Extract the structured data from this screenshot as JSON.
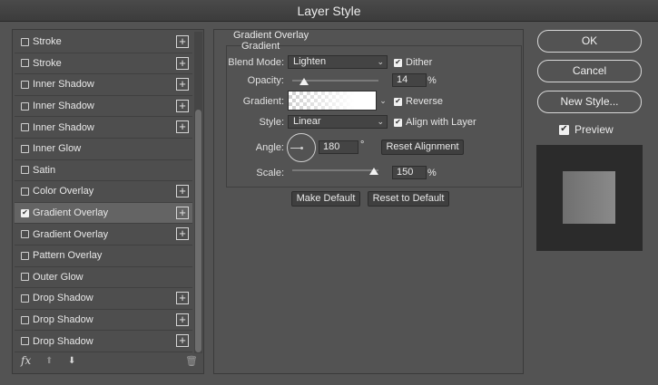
{
  "window": {
    "title": "Layer Style"
  },
  "styles_list": [
    {
      "label": "Stroke",
      "checked": false,
      "has_add": true
    },
    {
      "label": "Stroke",
      "checked": false,
      "has_add": true
    },
    {
      "label": "Inner Shadow",
      "checked": false,
      "has_add": true
    },
    {
      "label": "Inner Shadow",
      "checked": false,
      "has_add": true
    },
    {
      "label": "Inner Shadow",
      "checked": false,
      "has_add": true
    },
    {
      "label": "Inner Glow",
      "checked": false,
      "has_add": false
    },
    {
      "label": "Satin",
      "checked": false,
      "has_add": false
    },
    {
      "label": "Color Overlay",
      "checked": false,
      "has_add": true
    },
    {
      "label": "Gradient Overlay",
      "checked": true,
      "has_add": true,
      "selected": true
    },
    {
      "label": "Gradient Overlay",
      "checked": false,
      "has_add": true
    },
    {
      "label": "Pattern Overlay",
      "checked": false,
      "has_add": false
    },
    {
      "label": "Outer Glow",
      "checked": false,
      "has_add": false
    },
    {
      "label": "Drop Shadow",
      "checked": false,
      "has_add": true
    },
    {
      "label": "Drop Shadow",
      "checked": false,
      "has_add": true
    },
    {
      "label": "Drop Shadow",
      "checked": false,
      "has_add": true
    }
  ],
  "list_toolbar": {
    "fx_label": "fx",
    "up_icon": "arrow-up-icon",
    "down_icon": "arrow-down-icon",
    "trash_icon": "trash-icon"
  },
  "gradient_overlay": {
    "section_title": "Gradient Overlay",
    "group_title": "Gradient",
    "blend_mode_label": "Blend Mode:",
    "blend_mode_value": "Lighten",
    "dither_label": "Dither",
    "dither_checked": true,
    "opacity_label": "Opacity:",
    "opacity_value": "14",
    "opacity_fraction": 0.14,
    "opacity_unit": "%",
    "gradient_label": "Gradient:",
    "reverse_label": "Reverse",
    "reverse_checked": true,
    "style_label": "Style:",
    "style_value": "Linear",
    "align_label": "Align with Layer",
    "align_checked": true,
    "angle_label": "Angle:",
    "angle_value": "180",
    "angle_unit": "°",
    "reset_alignment_label": "Reset Alignment",
    "scale_label": "Scale:",
    "scale_value": "150",
    "scale_fraction": 0.95,
    "scale_unit": "%",
    "make_default_label": "Make Default",
    "reset_default_label": "Reset to Default"
  },
  "actions": {
    "ok_label": "OK",
    "cancel_label": "Cancel",
    "new_style_label": "New Style...",
    "preview_label": "Preview",
    "preview_checked": true
  },
  "colors": {
    "panel_bg": "#535353",
    "selected_row": "#646464",
    "preview_bg": "#2b2b2b"
  }
}
